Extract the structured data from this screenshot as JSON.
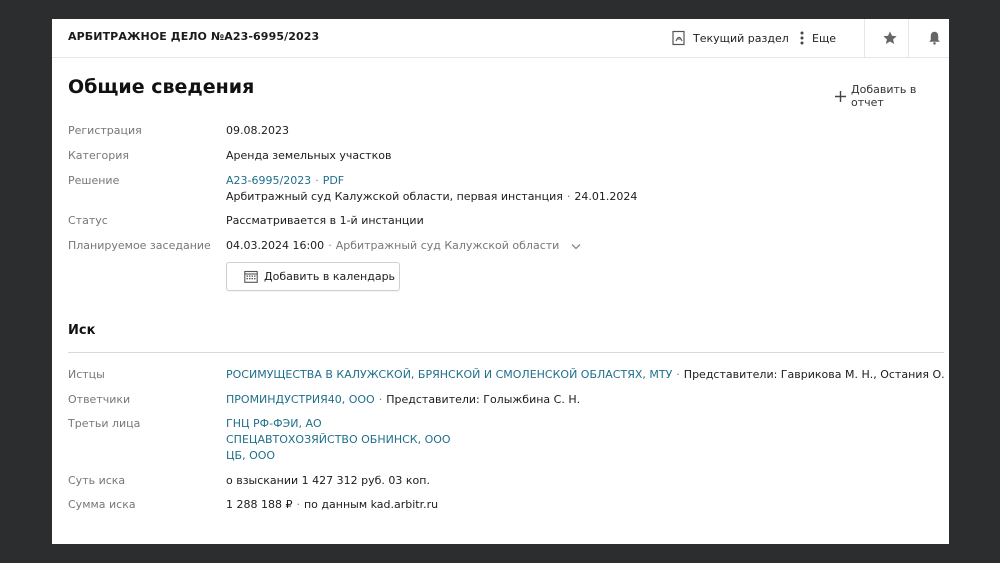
{
  "header": {
    "case_title": "АРБИТРАЖНОЕ ДЕЛО №А23-6995/2023",
    "current_section_label": "Текущий раздел",
    "more_label": "Еще",
    "icons": [
      "pdf-icon",
      "kebab-icon",
      "star-icon",
      "bell-icon"
    ]
  },
  "general": {
    "title": "Общие сведения",
    "add_to_report": "Добавить в отчет",
    "registration": {
      "label": "Регистрация",
      "value": "09.08.2023"
    },
    "category": {
      "label": "Категория",
      "value": "Аренда земельных участков"
    },
    "decision": {
      "label": "Решение",
      "case_link": "А23-6995/2023",
      "pdf_link": "PDF",
      "court": "Арбитражный суд Калужской области, первая инстанция",
      "date": "24.01.2024"
    },
    "status": {
      "label": "Статус",
      "value": "Рассматривается в 1-й инстанции"
    },
    "hearing": {
      "label": "Планируемое заседание",
      "datetime": "04.03.2024 16:00",
      "court": "Арбитражный суд Калужской области"
    },
    "calendar_button": "Добавить в календарь"
  },
  "claim": {
    "title": "Иск",
    "plaintiffs": {
      "label": "Истцы",
      "name": "РОСИМУЩЕСТВА В КАЛУЖСКОЙ, БРЯНСКОЙ И СМОЛЕНСКОЙ ОБЛАСТЯХ, МТУ",
      "reps": "Представители: Гаврикова М. Н., Остания О. В."
    },
    "defendants": {
      "label": "Ответчики",
      "name": "ПРОМИНДУСТРИЯ40, ООО",
      "reps": "Представители: Голыжбина С. Н."
    },
    "third_parties": {
      "label": "Третьи лица",
      "items": [
        "ГНЦ РФ-ФЭИ, АО",
        "СПЕЦАВТОХОЗЯЙСТВО ОБНИНСК, ООО",
        "ЦБ, ООО"
      ]
    },
    "essence": {
      "label": "Суть иска",
      "value": "о взыскании 1 427 312 руб. 03 коп."
    },
    "amount": {
      "label": "Сумма иска",
      "value": "1 288 188 ₽",
      "source": "по данным kad.arbitr.ru"
    }
  },
  "colors": {
    "link": "#1f6f8b",
    "label": "#777777",
    "background": "#2b2d2f"
  }
}
